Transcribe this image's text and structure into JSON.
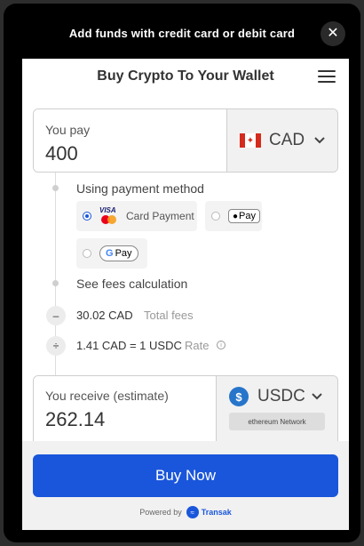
{
  "modal": {
    "title": "Add funds with credit card or debit card",
    "close_symbol": "✕"
  },
  "widget": {
    "title": "Buy Crypto To Your Wallet"
  },
  "pay": {
    "label": "You pay",
    "amount": "400",
    "currency": "CAD"
  },
  "payment_method": {
    "heading": "Using payment method",
    "options": [
      {
        "label": "Card Payment",
        "selected": true
      },
      {
        "label": "Pay",
        "brand": "apple",
        "selected": false
      },
      {
        "label": "Pay",
        "brand": "google",
        "selected": false
      }
    ],
    "card_brand": "VISA"
  },
  "fees": {
    "heading": "See fees calculation",
    "total_value": "30.02 CAD",
    "total_label": "Total fees",
    "minus_symbol": "–",
    "rate_value": "1.41 CAD = 1 USDC",
    "rate_label": "Rate",
    "divide_symbol": "÷",
    "info_symbol": "i"
  },
  "receive": {
    "label": "You receive (estimate)",
    "amount": "262.14",
    "currency": "USDC",
    "network": "ethereum Network"
  },
  "actions": {
    "buy_label": "Buy Now",
    "powered_by": "Powered by",
    "provider": "Transak"
  },
  "colors": {
    "primary": "#1a56db",
    "usdc": "#2775ca",
    "flag_red": "#d52b1e"
  }
}
